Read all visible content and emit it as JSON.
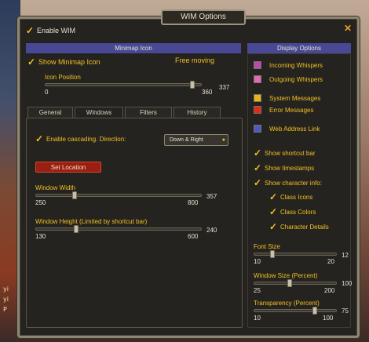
{
  "window": {
    "title": "WIM Options",
    "close_glyph": "✕"
  },
  "enable_wim": {
    "label": "Enable WIM",
    "checked": true
  },
  "minimap": {
    "header": "Minimap Icon",
    "show_icon": {
      "label": "Show Minimap Icon",
      "checked": true
    },
    "free_moving": {
      "label": "Free moving",
      "checked": false
    },
    "icon_position": {
      "label": "Icon Position",
      "min": "0",
      "max": "360",
      "value": "337"
    }
  },
  "tabs": [
    "General",
    "Windows",
    "Filters",
    "History"
  ],
  "windows_tab": {
    "cascading": {
      "label": "Enable cascading. Direction:",
      "checked": true
    },
    "direction": "Down & Right",
    "set_location": "Set Location",
    "width": {
      "label": "Window Width",
      "min": "250",
      "max": "800",
      "value": "357"
    },
    "height": {
      "label": "Window Height (Limited by shortcut bar)",
      "min": "130",
      "max": "600",
      "value": "240"
    }
  },
  "display": {
    "header": "Display Options",
    "colors": [
      {
        "label": "Incoming Whispers",
        "color": "#b84cb4"
      },
      {
        "label": "Outgoing Whispers",
        "color": "#e06ab8"
      },
      {
        "label": "System Messages",
        "color": "#e8b418"
      },
      {
        "label": "Error Messages",
        "color": "#e02a1a"
      },
      {
        "label": "Web Address Link",
        "color": "#4c5ac8"
      }
    ],
    "checks": [
      {
        "label": "Show shortcut bar",
        "checked": true
      },
      {
        "label": "Show timestamps",
        "checked": true
      },
      {
        "label": "Show character info:",
        "checked": true
      }
    ],
    "sub_checks": [
      {
        "label": "Class Icons",
        "checked": true
      },
      {
        "label": "Class Colors",
        "checked": true
      },
      {
        "label": "Character Details",
        "checked": true
      }
    ],
    "font_size": {
      "label": "Font Size",
      "min": "10",
      "max": "20",
      "value": "12"
    },
    "window_size": {
      "label": "Window Size (Percent)",
      "min": "25",
      "max": "200",
      "value": "100"
    },
    "transparency": {
      "label": "Transparency (Percent)",
      "min": "10",
      "max": "100",
      "value": "75"
    }
  },
  "background": {
    "left_text": [
      "yi",
      "yi",
      "P"
    ]
  }
}
